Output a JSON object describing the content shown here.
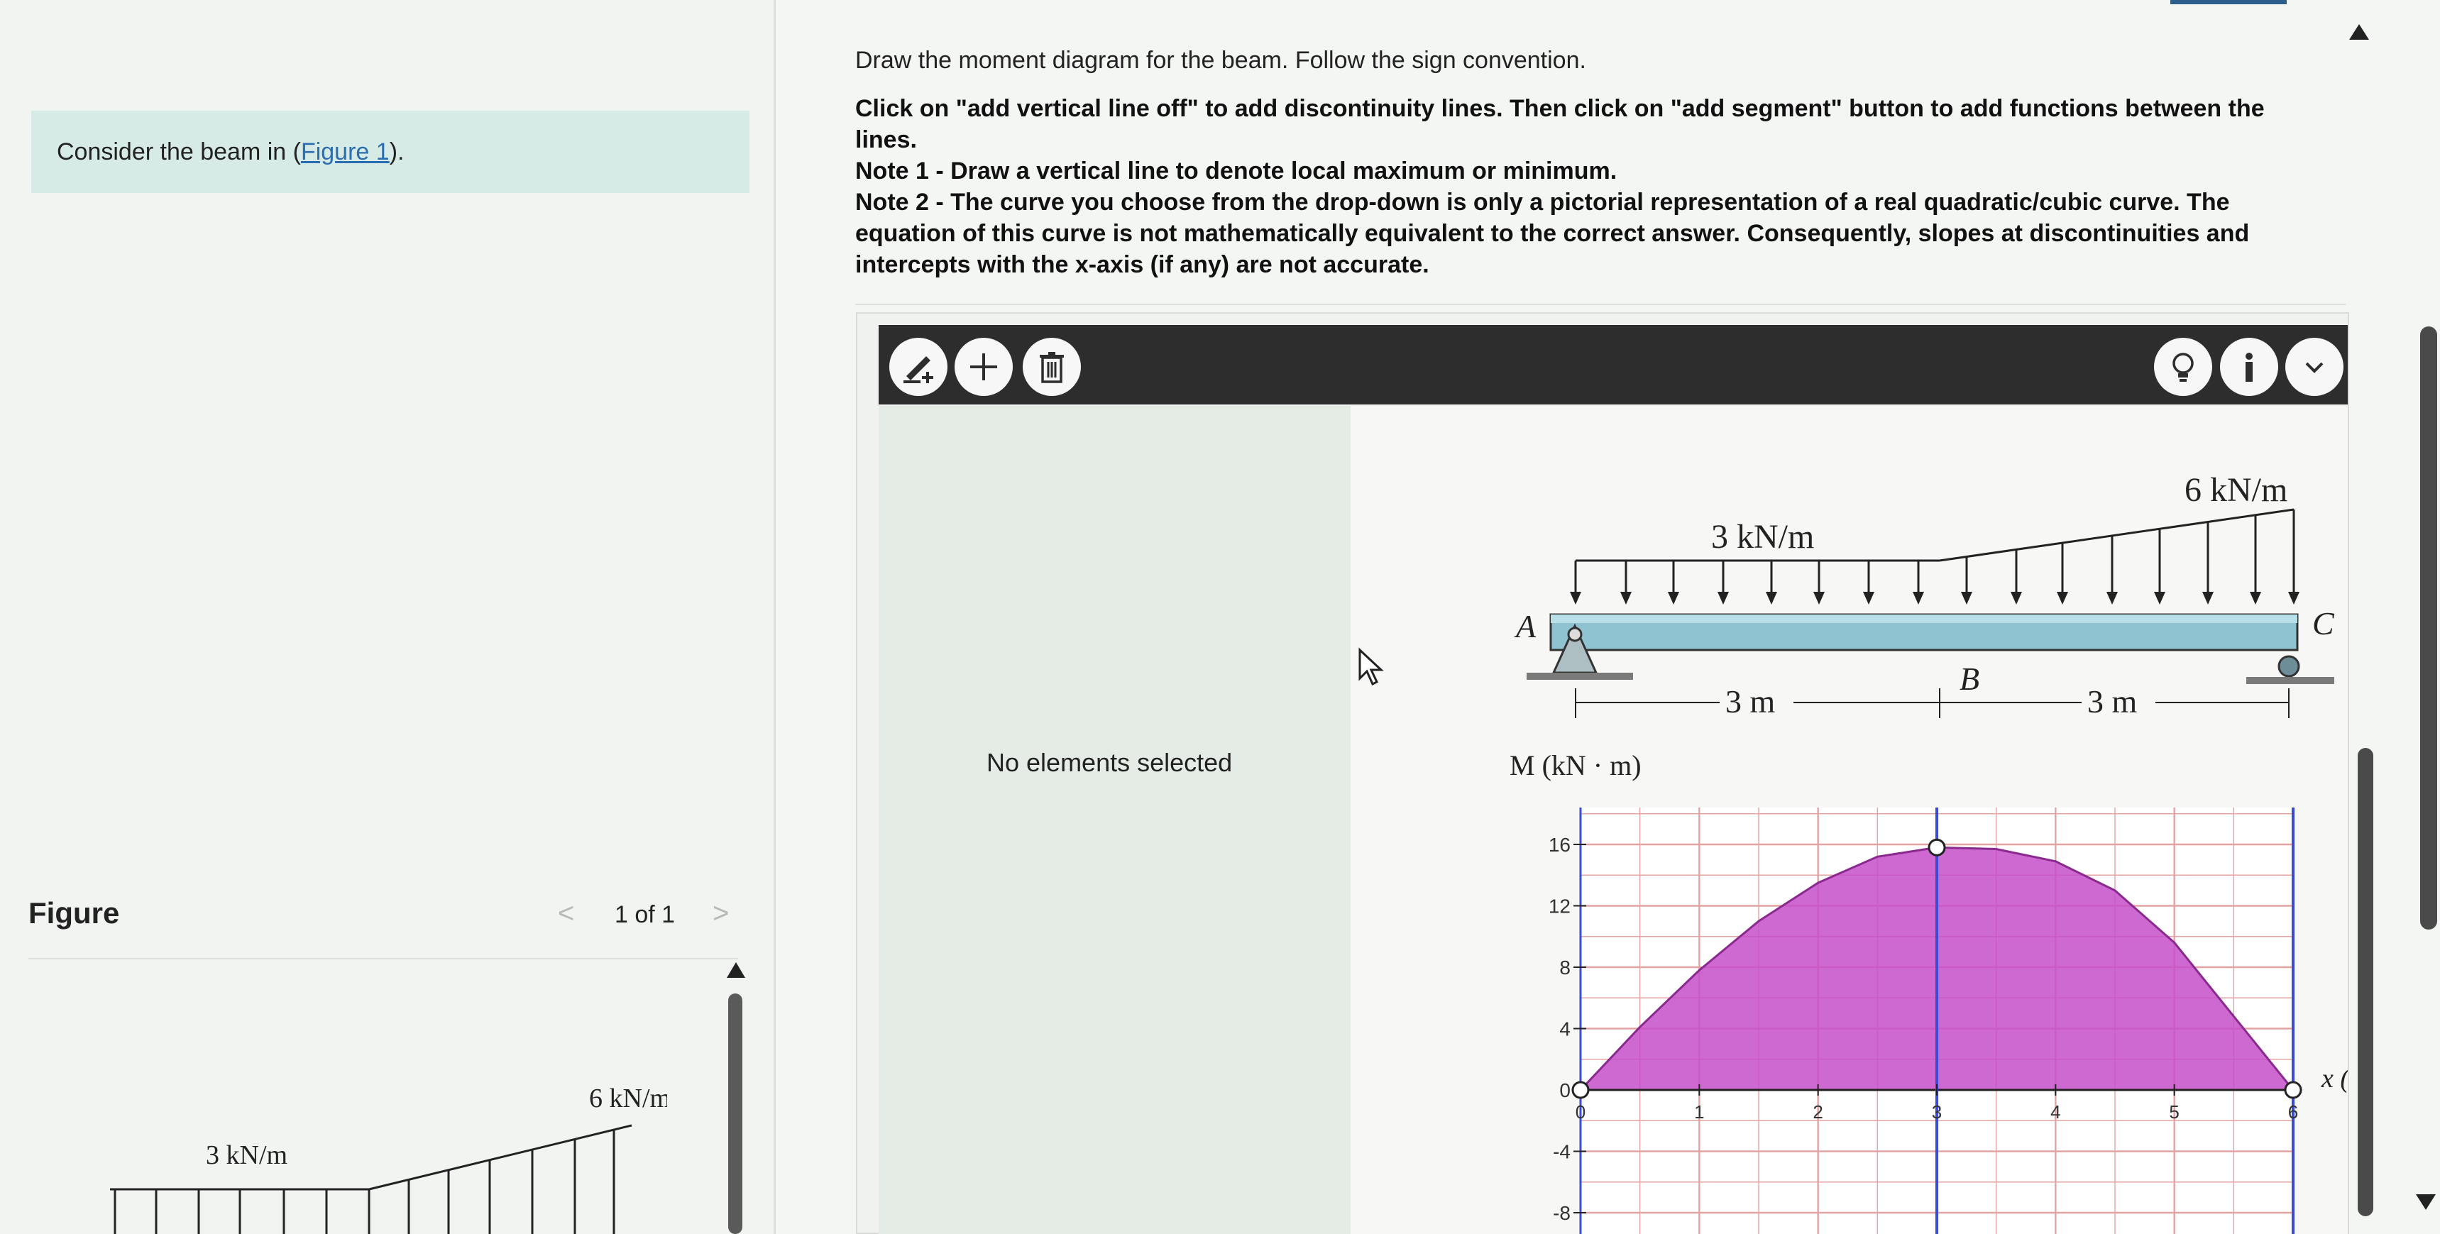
{
  "left": {
    "prompt_prefix": "Consider the beam in (",
    "prompt_link": "Figure 1",
    "prompt_suffix": ").",
    "figure_title": "Figure",
    "figure_nav": "1 of 1",
    "prev_icon": "<",
    "next_icon": ">",
    "figure_load_left": "3 kN/m",
    "figure_load_right": "6 kN/m"
  },
  "instructions": {
    "lead": "Draw the moment diagram for the beam. Follow the sign convention.",
    "line1": "Click on \"add vertical line off\" to add discontinuity lines. Then click on \"add segment\" button to add functions between the lines.",
    "line2": "Note 1 - Draw a vertical line to denote local maximum or minimum.",
    "line3": "Note 2 - The curve you choose from the drop-down is only a pictorial representation of a real quadratic/cubic curve. The equation of this curve is not mathematically equivalent to the correct answer. Consequently, slopes at discontinuities and intercepts with the x-axis (if any) are not accurate."
  },
  "toolbar": {
    "buttons": [
      "add-vertical-line-icon",
      "add-segment-icon",
      "trash-icon"
    ],
    "right_buttons": [
      "hint-bulb-icon",
      "info-icon",
      "chevron-down-icon"
    ]
  },
  "sidebar": {
    "status": "No elements selected"
  },
  "beam": {
    "load_left": "3 kN/m",
    "load_right": "6 kN/m",
    "label_a": "A",
    "label_b": "B",
    "label_c": "C",
    "span_left": "3 m",
    "span_right": "3 m"
  },
  "chart_data": {
    "type": "area",
    "ylabel": "M (kN · m)",
    "xlabel": "x (",
    "xlim": [
      0,
      6
    ],
    "ylim": [
      -8,
      18
    ],
    "x_ticks": [
      0,
      1,
      2,
      3,
      4,
      5,
      6
    ],
    "y_ticks": [
      -8,
      -4,
      0,
      4,
      8,
      12,
      16
    ],
    "fill_color": "#c54fc9",
    "vertical_line_x": 3,
    "curve_points": [
      {
        "x": 0,
        "y": 0
      },
      {
        "x": 0.5,
        "y": 4.1
      },
      {
        "x": 1,
        "y": 7.8
      },
      {
        "x": 1.5,
        "y": 11.0
      },
      {
        "x": 2,
        "y": 13.5
      },
      {
        "x": 2.5,
        "y": 15.2
      },
      {
        "x": 3,
        "y": 15.8
      },
      {
        "x": 3.5,
        "y": 15.7
      },
      {
        "x": 4,
        "y": 14.9
      },
      {
        "x": 4.5,
        "y": 13.0
      },
      {
        "x": 5,
        "y": 9.6
      },
      {
        "x": 5.5,
        "y": 4.8
      },
      {
        "x": 6,
        "y": 0
      }
    ],
    "handles": [
      {
        "x": 0,
        "y": 0
      },
      {
        "x": 3,
        "y": 15.8
      },
      {
        "x": 6,
        "y": 0
      }
    ]
  }
}
